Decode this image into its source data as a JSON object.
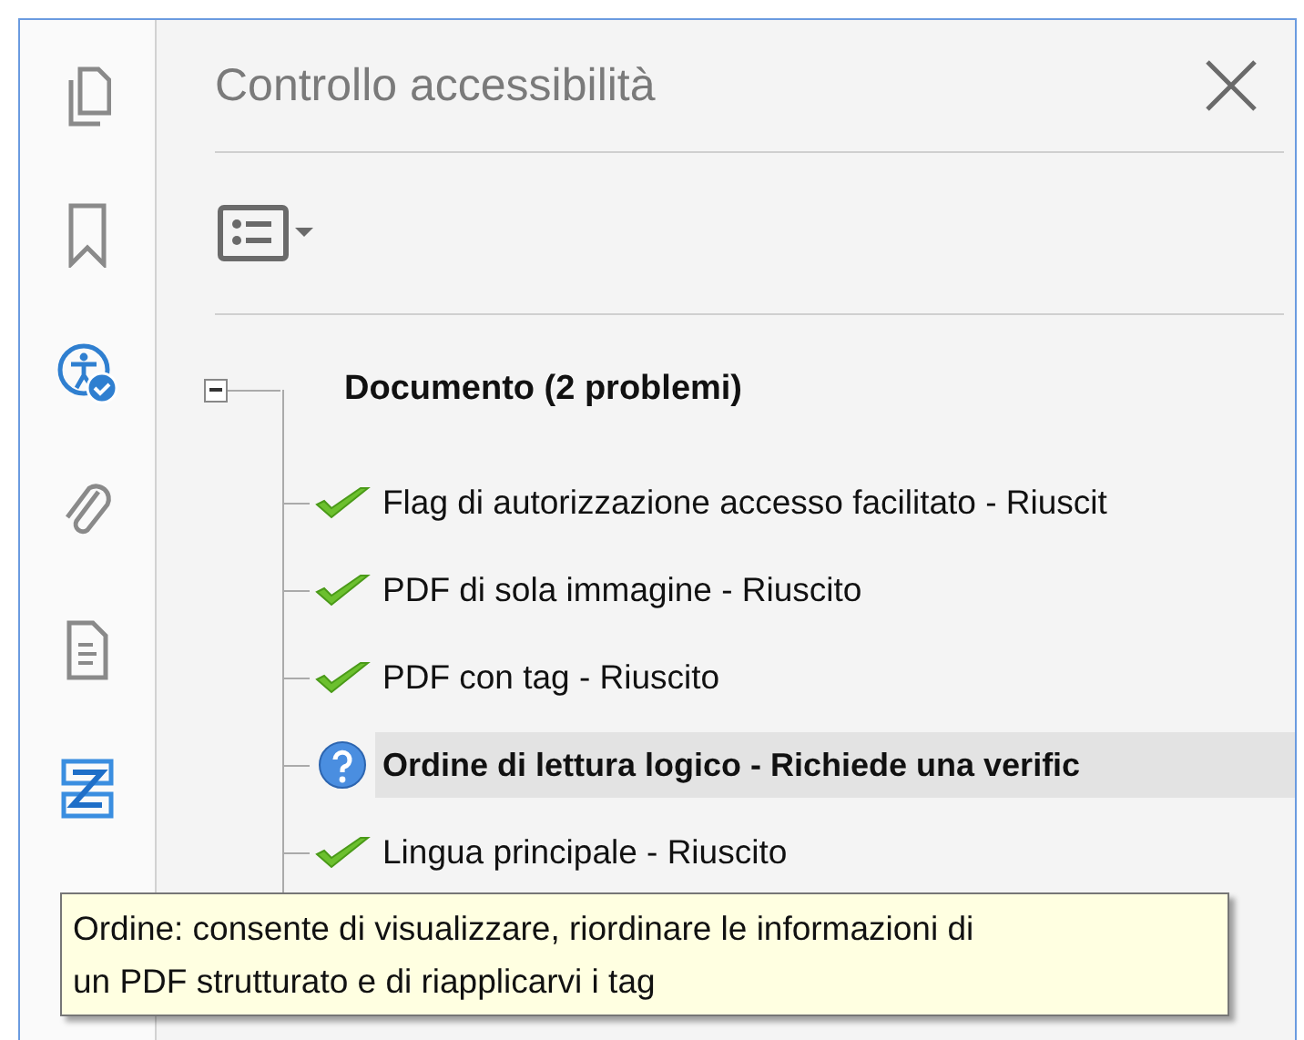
{
  "sidebar": {
    "items": [
      {
        "kind": "pages"
      },
      {
        "kind": "bookmark"
      },
      {
        "kind": "accessibility"
      },
      {
        "kind": "attachment"
      },
      {
        "kind": "document"
      },
      {
        "kind": "structure"
      }
    ]
  },
  "panel": {
    "title": "Controllo accessibilità"
  },
  "tree": [
    {
      "label": "Documento (2 problemi)",
      "expanded": true,
      "children": [
        {
          "label": "Flag di autorizzazione accesso facilitato - Riuscit",
          "kind": "pass",
          "selected": false
        },
        {
          "label": "PDF di sola immagine - Riuscito",
          "kind": "pass",
          "selected": false
        },
        {
          "label": "PDF con tag - Riuscito",
          "kind": "pass",
          "selected": false
        },
        {
          "label": "Ordine di lettura logico - Richiede una verific",
          "kind": "question",
          "selected": true
        },
        {
          "label": "Lingua principale - Riuscito",
          "kind": "pass",
          "selected": false
        }
      ]
    }
  ],
  "tooltip": {
    "lines": [
      "Ordine: consente di visualizzare, riordinare le informazioni di",
      "un PDF strutturato e di riapplicarvi i tag"
    ]
  }
}
